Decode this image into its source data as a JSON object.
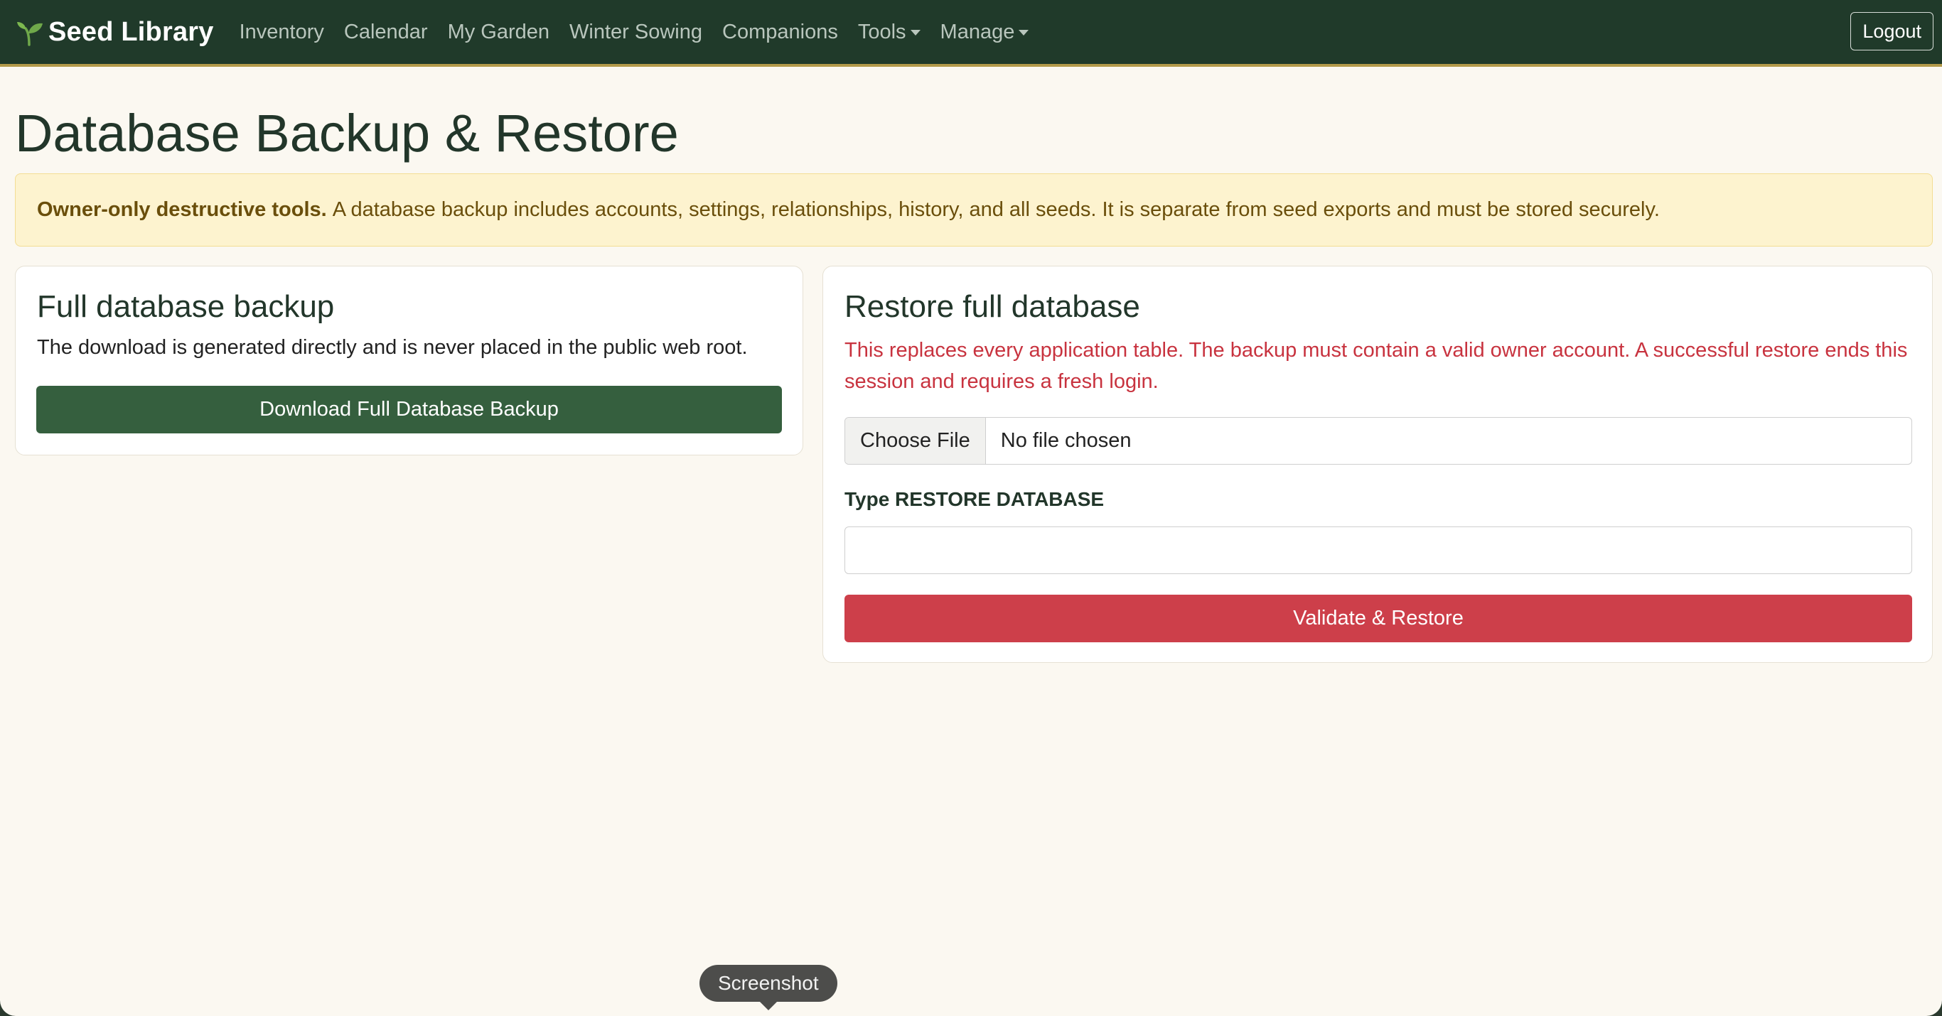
{
  "navbar": {
    "brand": "Seed Library",
    "brand_icon": "sprout-icon",
    "links": [
      {
        "label": "Inventory"
      },
      {
        "label": "Calendar"
      },
      {
        "label": "My Garden"
      },
      {
        "label": "Winter Sowing"
      },
      {
        "label": "Companions"
      },
      {
        "label": "Tools"
      },
      {
        "label": "Manage"
      }
    ],
    "logout": "Logout"
  },
  "page": {
    "title": "Database Backup & Restore"
  },
  "alert": {
    "strong": "Owner-only destructive tools.",
    "text": "A database backup includes accounts, settings, relationships, history, and all seeds. It is separate from seed exports and must be stored securely."
  },
  "backup": {
    "title": "Full database backup",
    "text": "The download is generated directly and is never placed in the public web root.",
    "button": "Download Full Database Backup"
  },
  "restore": {
    "title": "Restore full database",
    "warning": "This replaces every application table. The backup must contain a valid owner account. A successful restore ends this session and requires a fresh login.",
    "file_button": "Choose File",
    "file_status": "No file chosen",
    "confirm_label": "Type RESTORE DATABASE",
    "confirm_value": "",
    "button": "Validate & Restore"
  },
  "tooltip": {
    "text": "Screenshot"
  },
  "colors": {
    "navbar_bg": "#203a2a",
    "primary_button": "#355f3e",
    "danger_button": "#cd3f4a",
    "danger_text": "#c8333f",
    "alert_bg": "#fdf3cf"
  }
}
